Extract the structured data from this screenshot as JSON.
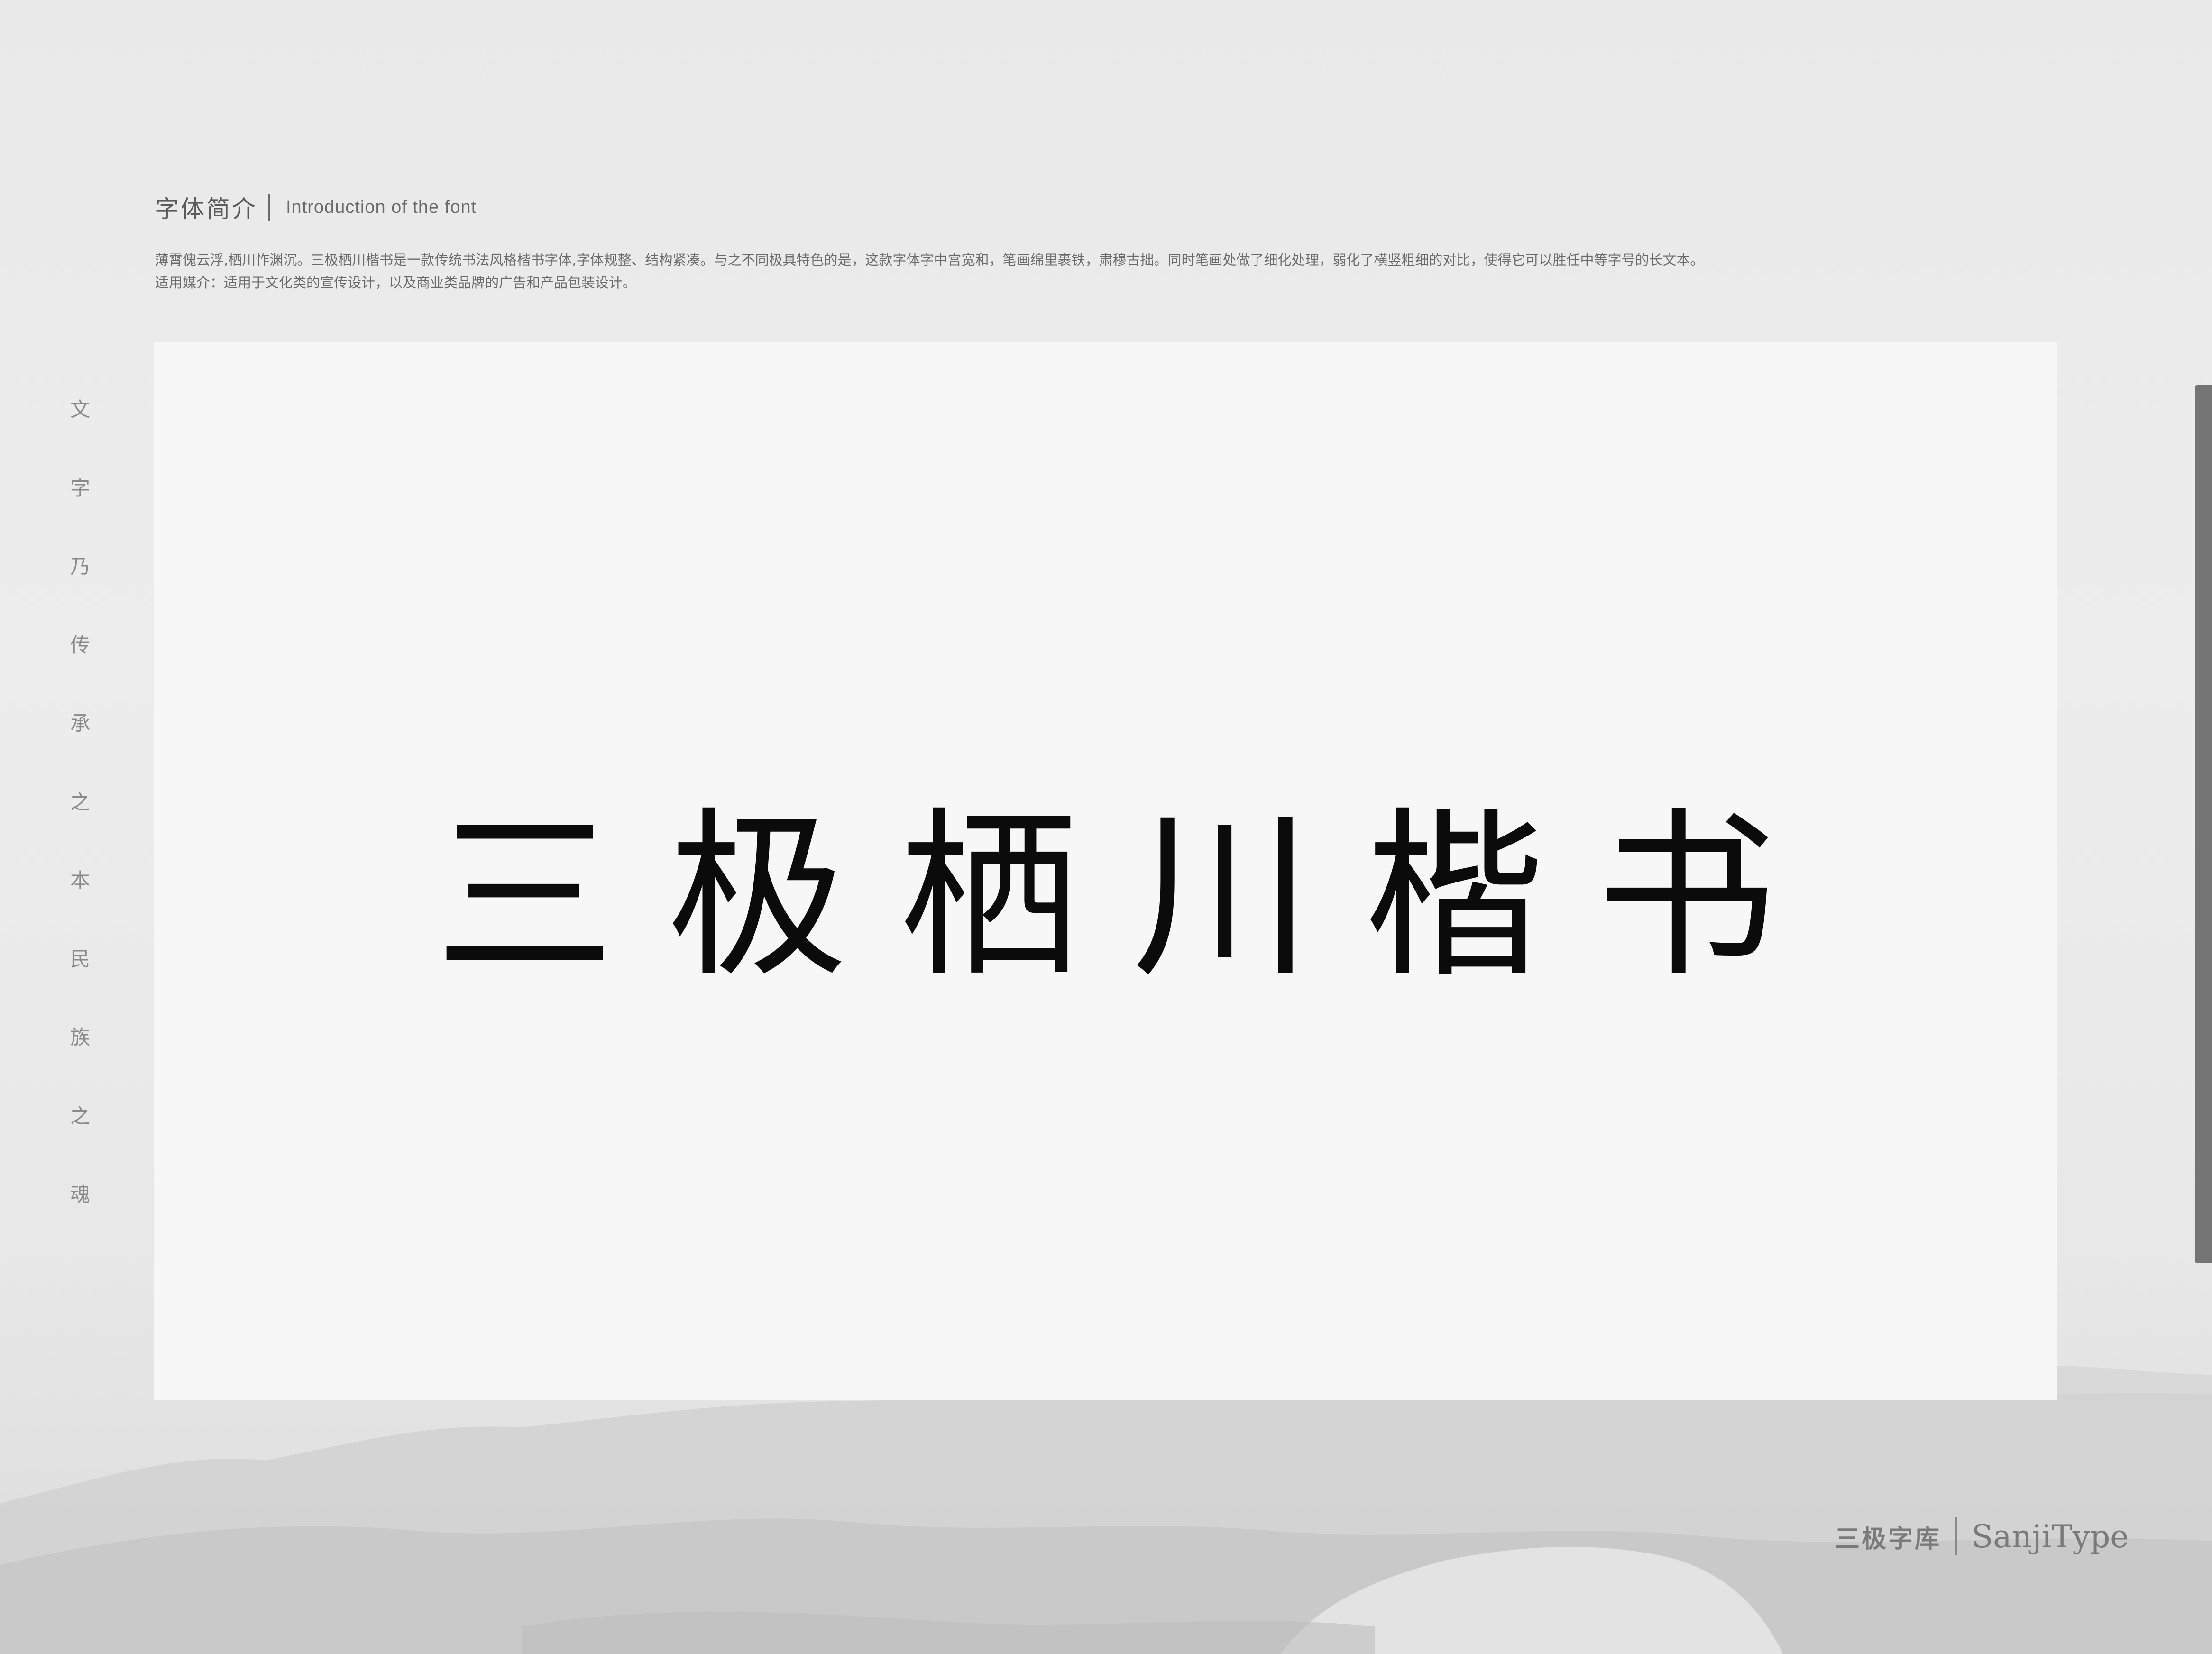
{
  "header": {
    "title_cn": "字体简介",
    "title_en": "Introduction of the font",
    "description_line1": "薄霄傀云浮,栖川怍渊沉。三极栖川楷书是一款传统书法风格楷书字体,字体规整、结构紧凑。与之不同极具特色的是，这款字体字中宫宽和，笔画绵里裹铁，肃穆古拙。同时笔画处做了细化处理，弱化了横竖粗细的对比，使得它可以胜任中等字号的长文本。",
    "description_line2": "适用媒介：适用于文化类的宣传设计，以及商业类品牌的广告和产品包装设计。"
  },
  "showcase": {
    "font_name": "三极栖川楷书"
  },
  "side_slogan": [
    "文",
    "字",
    "乃",
    "传",
    "承",
    "之",
    "本",
    "民",
    "族",
    "之",
    "魂"
  ],
  "brand": {
    "name_cn": "三极字库",
    "name_en": "SanjiType"
  },
  "colors": {
    "background": "#ebebeb",
    "card": "#f7f7f7",
    "ink": "#0b0b0b",
    "text_gray": "#6a6a6a",
    "scrollbar": "#757575"
  }
}
